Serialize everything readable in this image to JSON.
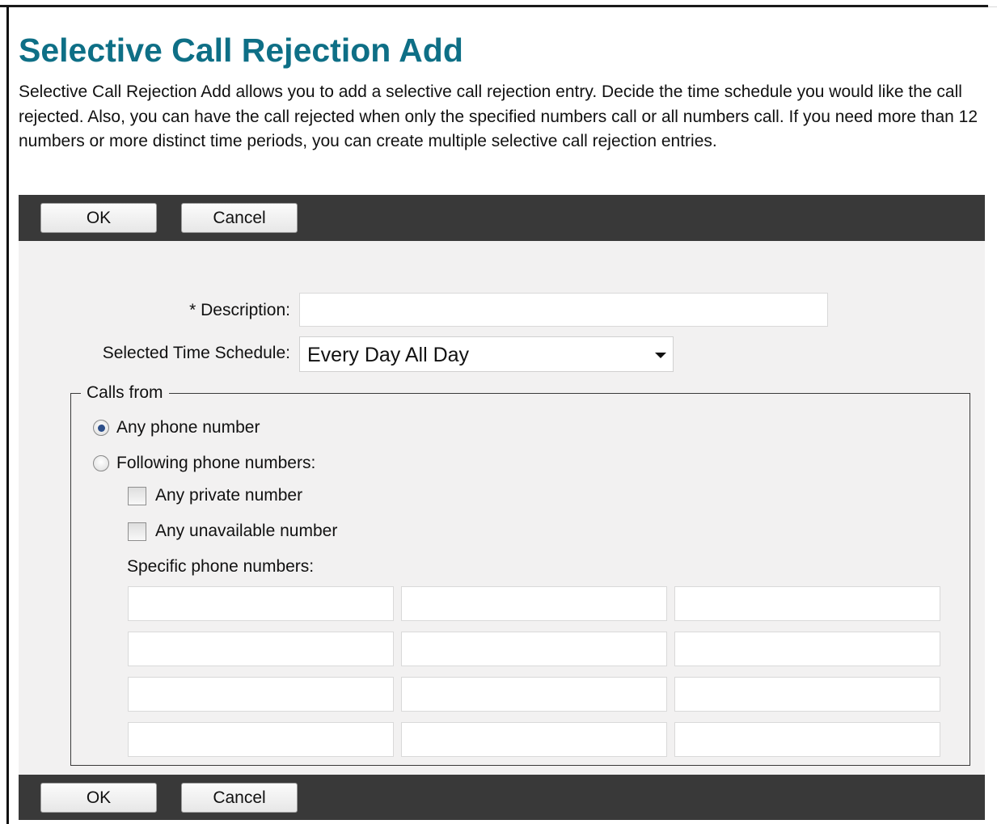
{
  "page": {
    "title": "Selective Call Rejection Add",
    "intro": "Selective Call Rejection Add allows you to add a selective call rejection entry. Decide the time schedule you would like the call rejected. Also, you can have the call rejected when only the specified numbers call or all numbers call. If you need more than 12 numbers or more distinct time periods, you can create multiple selective call rejection entries."
  },
  "toolbar": {
    "ok_label": "OK",
    "cancel_label": "Cancel"
  },
  "form": {
    "description_label": "* Description:",
    "description_value": "",
    "schedule_label": "Selected Time Schedule:",
    "schedule_value": "Every Day All Day",
    "calls_from_legend": "Calls from",
    "any_phone_label": "Any phone number",
    "any_phone_selected": true,
    "following_label": "Following phone numbers:",
    "following_selected": false,
    "private_label": "Any private number",
    "private_checked": false,
    "unavailable_label": "Any unavailable number",
    "unavailable_checked": false,
    "specific_label": "Specific phone numbers:",
    "specific_numbers": [
      "",
      "",
      "",
      "",
      "",
      "",
      "",
      "",
      "",
      "",
      "",
      ""
    ]
  },
  "colors": {
    "title": "#0e6f86",
    "toolbar": "#393939",
    "form_background": "#f2f1f1"
  },
  "icons": {
    "schedule_dropdown": "chevron-down-icon"
  }
}
